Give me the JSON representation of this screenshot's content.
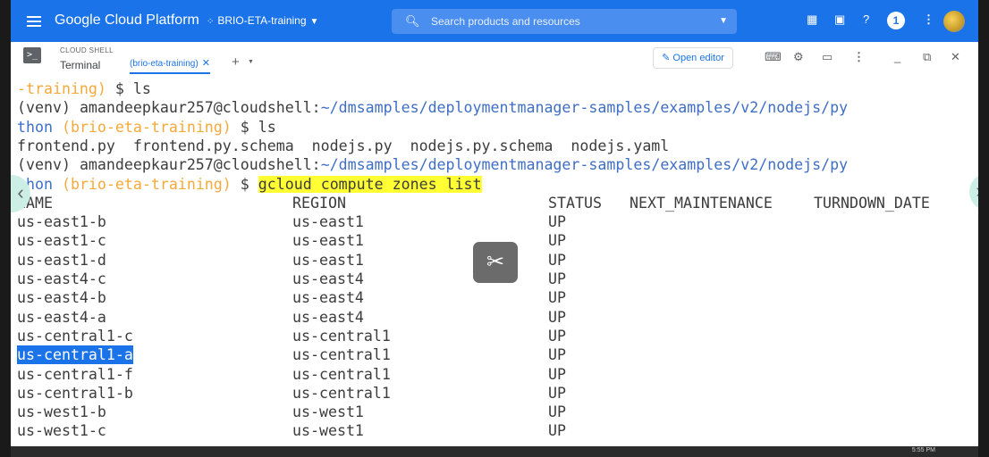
{
  "topbar": {
    "product": "Google Cloud Platform",
    "project": "BRIO-ETA-training",
    "search_placeholder": "Search products and resources",
    "notification_count": "1"
  },
  "shell": {
    "label": "CLOUD SHELL",
    "terminal_label": "Terminal",
    "tab_label": "(brio-eta-training)",
    "open_editor": "Open editor"
  },
  "terminal": {
    "line1": {
      "proj": "-training)",
      "rest": " $ ls"
    },
    "line2": {
      "env": "(venv) ",
      "user": "amandeepkaur257@cloudshell:",
      "path": "~/dmsamples/deploymentmanager-samples/examples/v2/nodejs/py"
    },
    "line3": {
      "path": "thon",
      "proj": " (brio-eta-training)",
      "rest": " $ ls"
    },
    "line4": "frontend.py  frontend.py.schema  nodejs.py  nodejs.py.schema  nodejs.yaml",
    "line5": {
      "env": "(venv) ",
      "user": "amandeepkaur257@cloudshell:",
      "path": "~/dmsamples/deploymentmanager-samples/examples/v2/nodejs/py"
    },
    "line6": {
      "path": "thon",
      "proj": " (brio-eta-training)",
      "prompt": " $ ",
      "command": "gcloud compute zones list"
    },
    "headers": [
      "NAME",
      "REGION",
      "STATUS",
      "NEXT_MAINTENANCE",
      "TURNDOWN_DATE"
    ],
    "rows": [
      [
        "us-east1-b",
        "us-east1",
        "UP"
      ],
      [
        "us-east1-c",
        "us-east1",
        "UP"
      ],
      [
        "us-east1-d",
        "us-east1",
        "UP"
      ],
      [
        "us-east4-c",
        "us-east4",
        "UP"
      ],
      [
        "us-east4-b",
        "us-east4",
        "UP"
      ],
      [
        "us-east4-a",
        "us-east4",
        "UP"
      ],
      [
        "us-central1-c",
        "us-central1",
        "UP"
      ],
      [
        "us-central1-a",
        "us-central1",
        "UP"
      ],
      [
        "us-central1-f",
        "us-central1",
        "UP"
      ],
      [
        "us-central1-b",
        "us-central1",
        "UP"
      ],
      [
        "us-west1-b",
        "us-west1",
        "UP"
      ],
      [
        "us-west1-c",
        "us-west1",
        "UP"
      ]
    ],
    "selected_row": 7
  },
  "taskbar": {
    "clock": "5:55 PM"
  },
  "colors": {
    "topbar": "#1a73e8",
    "path": "#3f6ec6",
    "project": "#f4a93a",
    "highlight": "#ffff33",
    "selection": "#1a73e8"
  },
  "icons": [
    "menu-icon",
    "project-dots-icon",
    "search-icon",
    "gift-icon",
    "console-icon",
    "help-icon",
    "more-vert-icon",
    "cloud-shell-icon",
    "close-icon",
    "add-icon",
    "pencil-icon",
    "keyboard-icon",
    "gear-icon",
    "preview-icon",
    "minimize-icon",
    "open-new-icon",
    "scissors-icon",
    "chevron-left-icon",
    "chevron-right-icon"
  ]
}
